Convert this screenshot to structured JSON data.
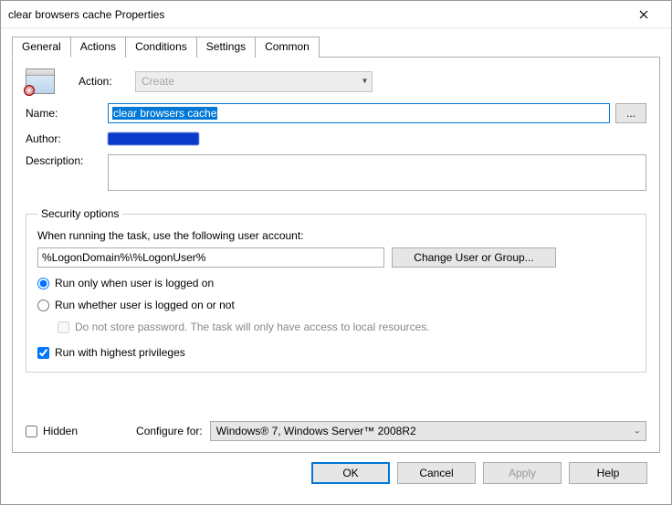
{
  "window": {
    "title": "clear browsers cache Properties"
  },
  "tabs": [
    "General",
    "Actions",
    "Conditions",
    "Settings",
    "Common"
  ],
  "general": {
    "action_label": "Action:",
    "action_value": "Create",
    "name_label": "Name:",
    "name_value": "clear browsers cache",
    "dots": "...",
    "author_label": "Author:",
    "description_label": "Description:",
    "description_value": ""
  },
  "security": {
    "legend": "Security options",
    "prompt": "When running the task, use the following user account:",
    "account": "%LogonDomain%\\%LogonUser%",
    "change_btn": "Change User or Group...",
    "radio_logged_on": "Run only when user is logged on",
    "radio_not_logged": "Run whether user is logged on or not",
    "do_not_store": "Do not store password. The task will only have access to local resources.",
    "highest": "Run with highest privileges"
  },
  "bottom": {
    "hidden": "Hidden",
    "configure_for": "Configure for:",
    "configure_value": "Windows® 7, Windows Server™ 2008R2"
  },
  "buttons": {
    "ok": "OK",
    "cancel": "Cancel",
    "apply": "Apply",
    "help": "Help"
  }
}
